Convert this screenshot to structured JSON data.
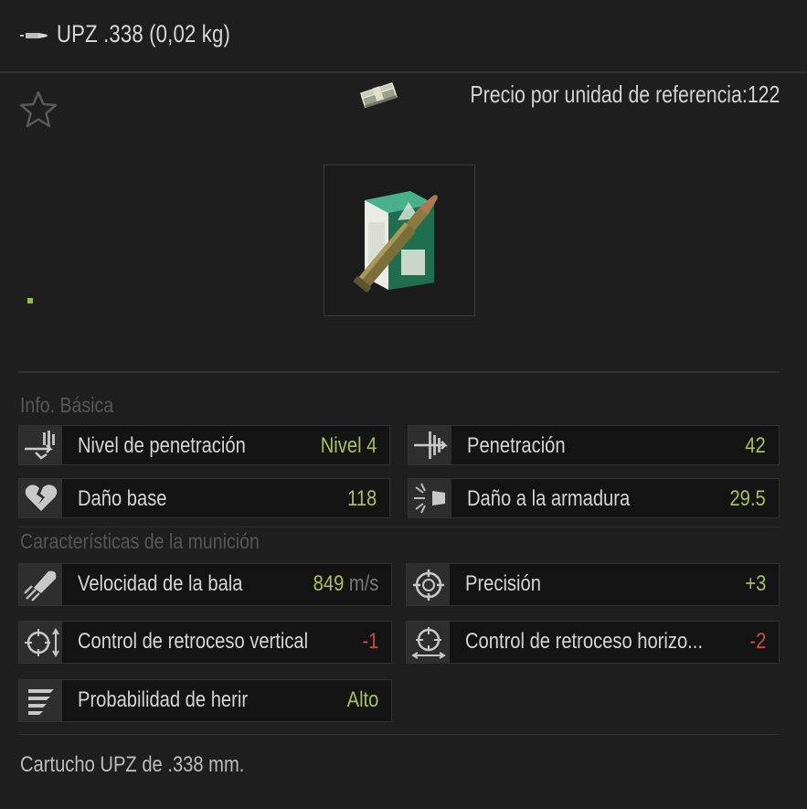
{
  "header": {
    "title": "UPZ .338 (0,02 kg)",
    "icon": "bullet-icon"
  },
  "price": {
    "label": "Precio por unidad de referencia:122",
    "icon": "money-stack-icon"
  },
  "favorite": {
    "icon": "star-icon"
  },
  "item": {
    "icon": "ammo-box-icon"
  },
  "sections": {
    "basic": "Info. Básica",
    "ammo": "Características de la munición"
  },
  "basic_stats": [
    {
      "label": "Nivel de penetración",
      "value": "Nivel 4",
      "icon": "penetration-level-icon"
    },
    {
      "label": "Penetración",
      "value": "42",
      "icon": "penetration-icon"
    },
    {
      "label": "Daño base",
      "value": "118",
      "icon": "broken-heart-icon"
    },
    {
      "label": "Daño a la armadura",
      "value": "29.5",
      "icon": "armor-damage-icon"
    }
  ],
  "ammo_stats": [
    {
      "label": "Velocidad de la bala",
      "value": "849",
      "unit": "m/s",
      "icon": "bullet-speed-icon"
    },
    {
      "label": "Precisión",
      "value": "+3",
      "icon": "crosshair-icon"
    },
    {
      "label": "Control de retroceso vertical",
      "value": "-1",
      "icon": "vertical-recoil-icon"
    },
    {
      "label": "Control de retroceso horizo...",
      "value": "-2",
      "icon": "horizontal-recoil-icon"
    },
    {
      "label": "Probabilidad de herir",
      "value": "Alto",
      "icon": "wound-chance-icon"
    }
  ],
  "description": "Cartucho UPZ de .338 mm.",
  "colors": {
    "positive": "#a8c060",
    "negative": "#c8503a",
    "background": "#1f1f1f"
  }
}
